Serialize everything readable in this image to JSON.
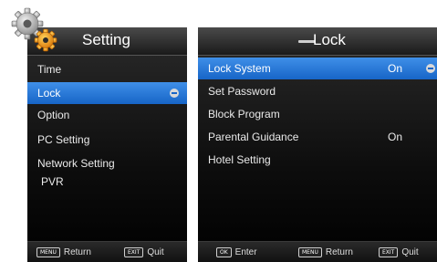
{
  "left_panel": {
    "title": "Setting",
    "items": [
      {
        "label": "Time"
      },
      {
        "label": "Lock"
      },
      {
        "label": "Option"
      },
      {
        "label": "PC Setting"
      },
      {
        "label": "Network Setting"
      },
      {
        "label": "PVR"
      }
    ],
    "selected_index": 1,
    "footer": {
      "return_badge": "MENU",
      "return_label": "Return",
      "quit_badge": "EXIT",
      "quit_label": "Quit"
    }
  },
  "right_panel": {
    "title": "Lock",
    "items": [
      {
        "label": "Lock System",
        "value": "On"
      },
      {
        "label": "Set Password",
        "value": ""
      },
      {
        "label": "Block Program",
        "value": ""
      },
      {
        "label": "Parental Guidance",
        "value": "On"
      },
      {
        "label": "Hotel Setting",
        "value": ""
      }
    ],
    "selected_index": 0,
    "footer": {
      "enter_badge": "OK",
      "enter_label": "Enter",
      "return_badge": "MENU",
      "return_label": "Return",
      "quit_badge": "EXIT",
      "quit_label": "Quit"
    }
  },
  "icons": {
    "logo": "gears-icon",
    "selection_arrow": "arrow-indicator-icon"
  },
  "colors": {
    "selection": "#1f76d8",
    "panel": "#1a1a1a",
    "gear_orange": "#f5a21a"
  }
}
